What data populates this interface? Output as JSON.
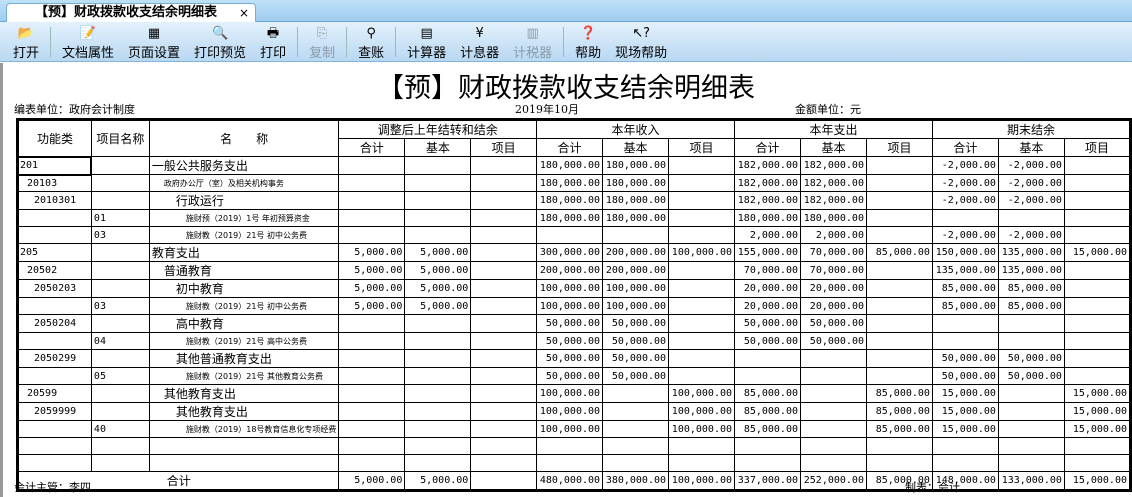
{
  "tab": {
    "title": "【预】财政拨款收支结余明细表",
    "close": "×"
  },
  "toolbar": [
    {
      "label": "打开",
      "icon": "folder-open-icon",
      "glyph": "📂"
    },
    {
      "sep": true
    },
    {
      "label": "文档属性",
      "icon": "document-properties-icon",
      "glyph": "📝"
    },
    {
      "label": "页面设置",
      "icon": "page-setup-icon",
      "glyph": "▦"
    },
    {
      "label": "打印预览",
      "icon": "print-preview-icon",
      "glyph": "🔍"
    },
    {
      "label": "打印",
      "icon": "printer-icon",
      "glyph": "🖶"
    },
    {
      "sep": true
    },
    {
      "label": "复制",
      "icon": "copy-icon",
      "glyph": "⎘",
      "disabled": true
    },
    {
      "sep": true
    },
    {
      "label": "查账",
      "icon": "magnifier-icon",
      "glyph": "⚲"
    },
    {
      "sep": true
    },
    {
      "label": "计算器",
      "icon": "calculator-icon",
      "glyph": "▤"
    },
    {
      "label": "计息器",
      "icon": "yen-icon",
      "glyph": "¥"
    },
    {
      "label": "计税器",
      "icon": "tax-calculator-icon",
      "glyph": "▥",
      "disabled": true
    },
    {
      "sep": true
    },
    {
      "label": "帮助",
      "icon": "help-icon",
      "glyph": "❓"
    },
    {
      "label": "现场帮助",
      "icon": "context-help-icon",
      "glyph": "↖?"
    }
  ],
  "report": {
    "title": "【预】财政拨款收支结余明细表",
    "unit": "编表单位：政府会计制度",
    "period": "2019年10月",
    "currency": "金额单位：元",
    "supervisor": "会计主管：李四",
    "preparer": "制表：会计"
  },
  "headers": {
    "func": "功能类",
    "proj": "项目名称",
    "name": "名　　称",
    "groups": [
      "调整后上年结转和结余",
      "本年收入",
      "本年支出",
      "期末结余"
    ],
    "sub": [
      "合计",
      "基本",
      "项目"
    ]
  },
  "rows": [
    {
      "code": "201",
      "ci": 0,
      "proj": "",
      "name": "一般公共服务支出",
      "lv": 0,
      "small": false,
      "v": [
        "",
        "",
        "",
        "180,000.00",
        "180,000.00",
        "",
        "182,000.00",
        "182,000.00",
        "",
        "-2,000.00",
        "-2,000.00",
        ""
      ]
    },
    {
      "code": "20103",
      "ci": 1,
      "proj": "",
      "name": "政府办公厅（室）及相关机构事务",
      "lv": 1,
      "small": true,
      "v": [
        "",
        "",
        "",
        "180,000.00",
        "180,000.00",
        "",
        "182,000.00",
        "182,000.00",
        "",
        "-2,000.00",
        "-2,000.00",
        ""
      ]
    },
    {
      "code": "2010301",
      "ci": 2,
      "proj": "",
      "name": "行政运行",
      "lv": 2,
      "small": false,
      "v": [
        "",
        "",
        "",
        "180,000.00",
        "180,000.00",
        "",
        "182,000.00",
        "182,000.00",
        "",
        "-2,000.00",
        "-2,000.00",
        ""
      ]
    },
    {
      "code": "",
      "ci": 0,
      "proj": "01",
      "name": "施财预（2019）1号 年初预算资金",
      "lv": 2,
      "small": true,
      "v": [
        "",
        "",
        "",
        "180,000.00",
        "180,000.00",
        "",
        "180,000.00",
        "180,000.00",
        "",
        "",
        "",
        ""
      ]
    },
    {
      "code": "",
      "ci": 0,
      "proj": "03",
      "name": "施财教（2019）21号 初中公务费",
      "lv": 2,
      "small": true,
      "v": [
        "",
        "",
        "",
        "",
        "",
        "",
        "2,000.00",
        "2,000.00",
        "",
        "-2,000.00",
        "-2,000.00",
        ""
      ]
    },
    {
      "code": "205",
      "ci": 0,
      "proj": "",
      "name": "教育支出",
      "lv": 0,
      "small": false,
      "v": [
        "5,000.00",
        "5,000.00",
        "",
        "300,000.00",
        "200,000.00",
        "100,000.00",
        "155,000.00",
        "70,000.00",
        "85,000.00",
        "150,000.00",
        "135,000.00",
        "15,000.00"
      ]
    },
    {
      "code": "20502",
      "ci": 1,
      "proj": "",
      "name": "普通教育",
      "lv": 1,
      "small": false,
      "v": [
        "5,000.00",
        "5,000.00",
        "",
        "200,000.00",
        "200,000.00",
        "",
        "70,000.00",
        "70,000.00",
        "",
        "135,000.00",
        "135,000.00",
        ""
      ]
    },
    {
      "code": "2050203",
      "ci": 2,
      "proj": "",
      "name": "初中教育",
      "lv": 2,
      "small": false,
      "v": [
        "5,000.00",
        "5,000.00",
        "",
        "100,000.00",
        "100,000.00",
        "",
        "20,000.00",
        "20,000.00",
        "",
        "85,000.00",
        "85,000.00",
        ""
      ]
    },
    {
      "code": "",
      "ci": 0,
      "proj": "03",
      "name": "施财教（2019）21号 初中公务费",
      "lv": 2,
      "small": true,
      "v": [
        "5,000.00",
        "5,000.00",
        "",
        "100,000.00",
        "100,000.00",
        "",
        "20,000.00",
        "20,000.00",
        "",
        "85,000.00",
        "85,000.00",
        ""
      ]
    },
    {
      "code": "2050204",
      "ci": 2,
      "proj": "",
      "name": "高中教育",
      "lv": 2,
      "small": false,
      "v": [
        "",
        "",
        "",
        "50,000.00",
        "50,000.00",
        "",
        "50,000.00",
        "50,000.00",
        "",
        "",
        "",
        ""
      ]
    },
    {
      "code": "",
      "ci": 0,
      "proj": "04",
      "name": "施财教（2019）21号 高中公务费",
      "lv": 2,
      "small": true,
      "v": [
        "",
        "",
        "",
        "50,000.00",
        "50,000.00",
        "",
        "50,000.00",
        "50,000.00",
        "",
        "",
        "",
        ""
      ]
    },
    {
      "code": "2050299",
      "ci": 2,
      "proj": "",
      "name": "其他普通教育支出",
      "lv": 2,
      "small": false,
      "v": [
        "",
        "",
        "",
        "50,000.00",
        "50,000.00",
        "",
        "",
        "",
        "",
        "50,000.00",
        "50,000.00",
        ""
      ]
    },
    {
      "code": "",
      "ci": 0,
      "proj": "05",
      "name": "施财教（2019）21号 其他教育公务费",
      "lv": 2,
      "small": true,
      "v": [
        "",
        "",
        "",
        "50,000.00",
        "50,000.00",
        "",
        "",
        "",
        "",
        "50,000.00",
        "50,000.00",
        ""
      ]
    },
    {
      "code": "20599",
      "ci": 1,
      "proj": "",
      "name": "其他教育支出",
      "lv": 1,
      "small": false,
      "v": [
        "",
        "",
        "",
        "100,000.00",
        "",
        "100,000.00",
        "85,000.00",
        "",
        "85,000.00",
        "15,000.00",
        "",
        "15,000.00"
      ]
    },
    {
      "code": "2059999",
      "ci": 2,
      "proj": "",
      "name": "其他教育支出",
      "lv": 2,
      "small": false,
      "v": [
        "",
        "",
        "",
        "100,000.00",
        "",
        "100,000.00",
        "85,000.00",
        "",
        "85,000.00",
        "15,000.00",
        "",
        "15,000.00"
      ]
    },
    {
      "code": "",
      "ci": 0,
      "proj": "40",
      "name": "施财教（2019）18号教育信息化专项经费",
      "lv": 2,
      "small": true,
      "v": [
        "",
        "",
        "",
        "100,000.00",
        "",
        "100,000.00",
        "85,000.00",
        "",
        "85,000.00",
        "15,000.00",
        "",
        "15,000.00"
      ]
    },
    {
      "code": "",
      "ci": 0,
      "proj": "",
      "name": "",
      "lv": 0,
      "small": false,
      "v": [
        "",
        "",
        "",
        "",
        "",
        "",
        "",
        "",
        "",
        "",
        "",
        ""
      ]
    },
    {
      "code": "",
      "ci": 0,
      "proj": "",
      "name": "",
      "lv": 0,
      "small": false,
      "v": [
        "",
        "",
        "",
        "",
        "",
        "",
        "",
        "",
        "",
        "",
        "",
        ""
      ]
    }
  ],
  "total": {
    "label": "合计",
    "v": [
      "5,000.00",
      "5,000.00",
      "",
      "480,000.00",
      "380,000.00",
      "100,000.00",
      "337,000.00",
      "252,000.00",
      "85,000.00",
      "148,000.00",
      "133,000.00",
      "15,000.00"
    ]
  }
}
